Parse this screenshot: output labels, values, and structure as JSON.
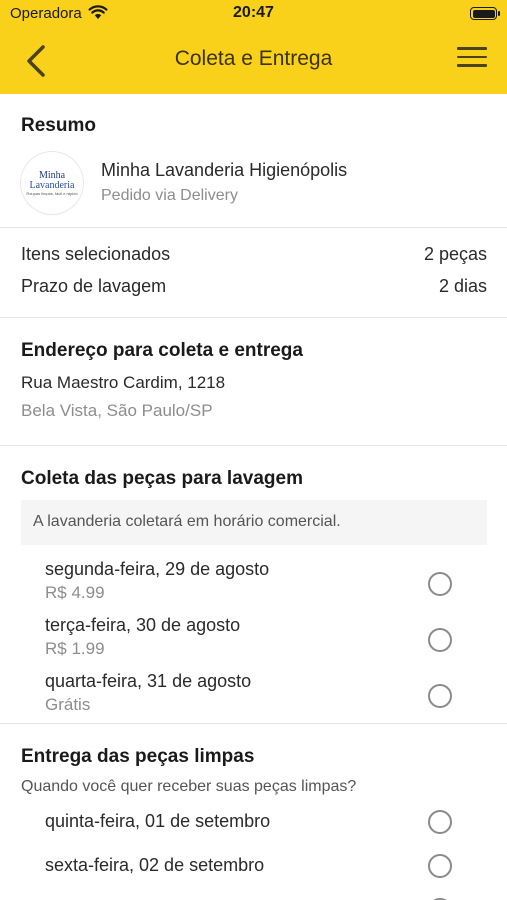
{
  "status_bar": {
    "carrier": "Operadora",
    "time": "20:47"
  },
  "nav": {
    "title": "Coleta e Entrega"
  },
  "summary": {
    "title": "Resumo",
    "logo_line1": "Minha",
    "logo_line2": "Lavanderia",
    "logo_line3": "Roupas limpas, fácil e rápido",
    "store_name": "Minha Lavanderia Higienópolis",
    "order_type": "Pedido via Delivery"
  },
  "info": {
    "items_label": "Itens selecionados",
    "items_value": "2 peças",
    "time_label": "Prazo de lavagem",
    "time_value": "2 dias"
  },
  "address": {
    "title": "Endereço para coleta e entrega",
    "line1": "Rua Maestro Cardim, 1218",
    "line2": "Bela Vista, São Paulo/SP"
  },
  "pickup": {
    "title": "Coleta das peças para lavagem",
    "notice": "A lavanderia coletará em horário comercial.",
    "options": [
      {
        "date": "segunda-feira, 29 de agosto",
        "price": "R$ 4.99"
      },
      {
        "date": "terça-feira, 30 de agosto",
        "price": "R$ 1.99"
      },
      {
        "date": "quarta-feira, 31 de agosto",
        "price": "Grátis"
      }
    ]
  },
  "delivery": {
    "title": "Entrega das peças limpas",
    "question": "Quando você quer receber suas peças limpas?",
    "options": [
      {
        "date": "quinta-feira, 01 de setembro"
      },
      {
        "date": "sexta-feira, 02 de setembro"
      }
    ]
  },
  "colors": {
    "accent": "#f9d11a"
  },
  "icons": {
    "back": "chevron-left-icon",
    "menu": "hamburger-menu-icon",
    "wifi": "wifi-icon",
    "battery": "battery-icon"
  }
}
